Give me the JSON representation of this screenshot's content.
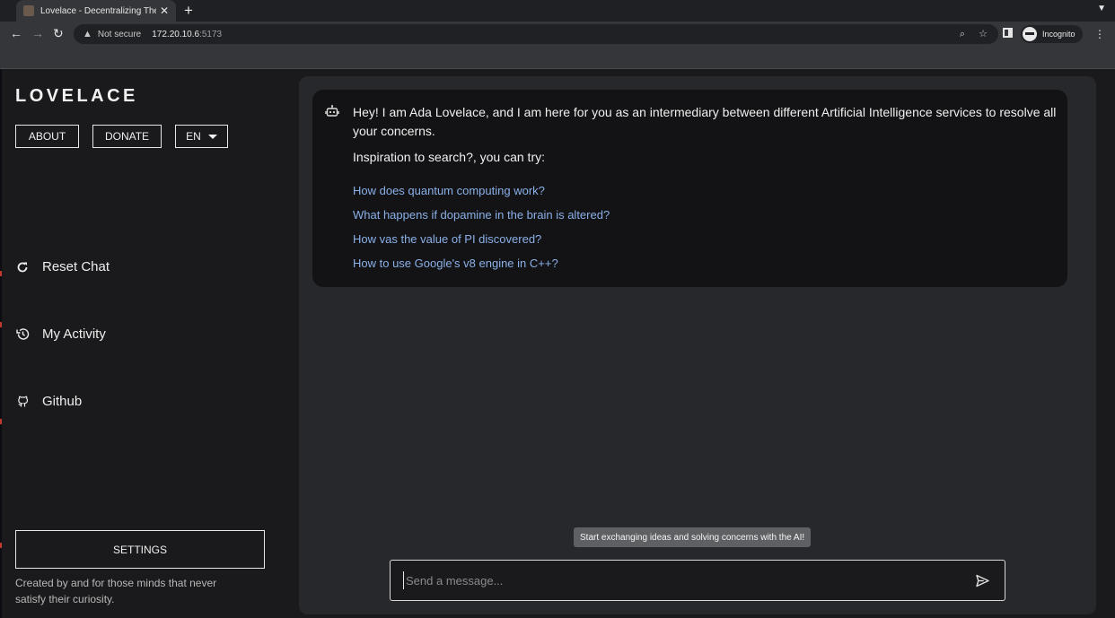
{
  "browser": {
    "tab_title": "Lovelace - Decentralizing The",
    "tab_close": "✕",
    "new_tab": "+",
    "security_label": "Not secure",
    "url_host": "172.20.10.6",
    "url_port": ":5173",
    "profile_label": "Incognito",
    "icons": [
      "back-icon",
      "forward-icon",
      "reload-icon",
      "zoom-icon",
      "star-icon",
      "side-panel-icon",
      "incognito-icon",
      "menu-icon"
    ]
  },
  "sidebar": {
    "logo": "LOVELACE",
    "about": "ABOUT",
    "donate": "DONATE",
    "language": "EN",
    "nav": [
      {
        "label": "Reset Chat",
        "icon": "refresh-icon"
      },
      {
        "label": "My Activity",
        "icon": "history-icon"
      },
      {
        "label": "Github",
        "icon": "github-icon"
      }
    ],
    "settings": "SETTINGS",
    "footer": "Created by and for those minds that never satisfy their curiosity."
  },
  "chat": {
    "greeting": "Hey! I am Ada Lovelace, and I am here for you as an intermediary between different Artificial Intelligence services to resolve all your concerns.",
    "inspiration": "Inspiration to search?, you can try:",
    "suggestions": [
      "How does quantum computing work?",
      "What happens if dopamine in the brain is altered?",
      "How vas the value of PI discovered?",
      "How to use Google's v8 engine in C++?"
    ],
    "tooltip": "Start exchanging ideas and solving concerns with the AI!",
    "input_placeholder": "Send a message...",
    "input_value": ""
  },
  "colors": {
    "link": "#8ab0e8",
    "panel": "#27282c",
    "bubble": "#131315"
  }
}
